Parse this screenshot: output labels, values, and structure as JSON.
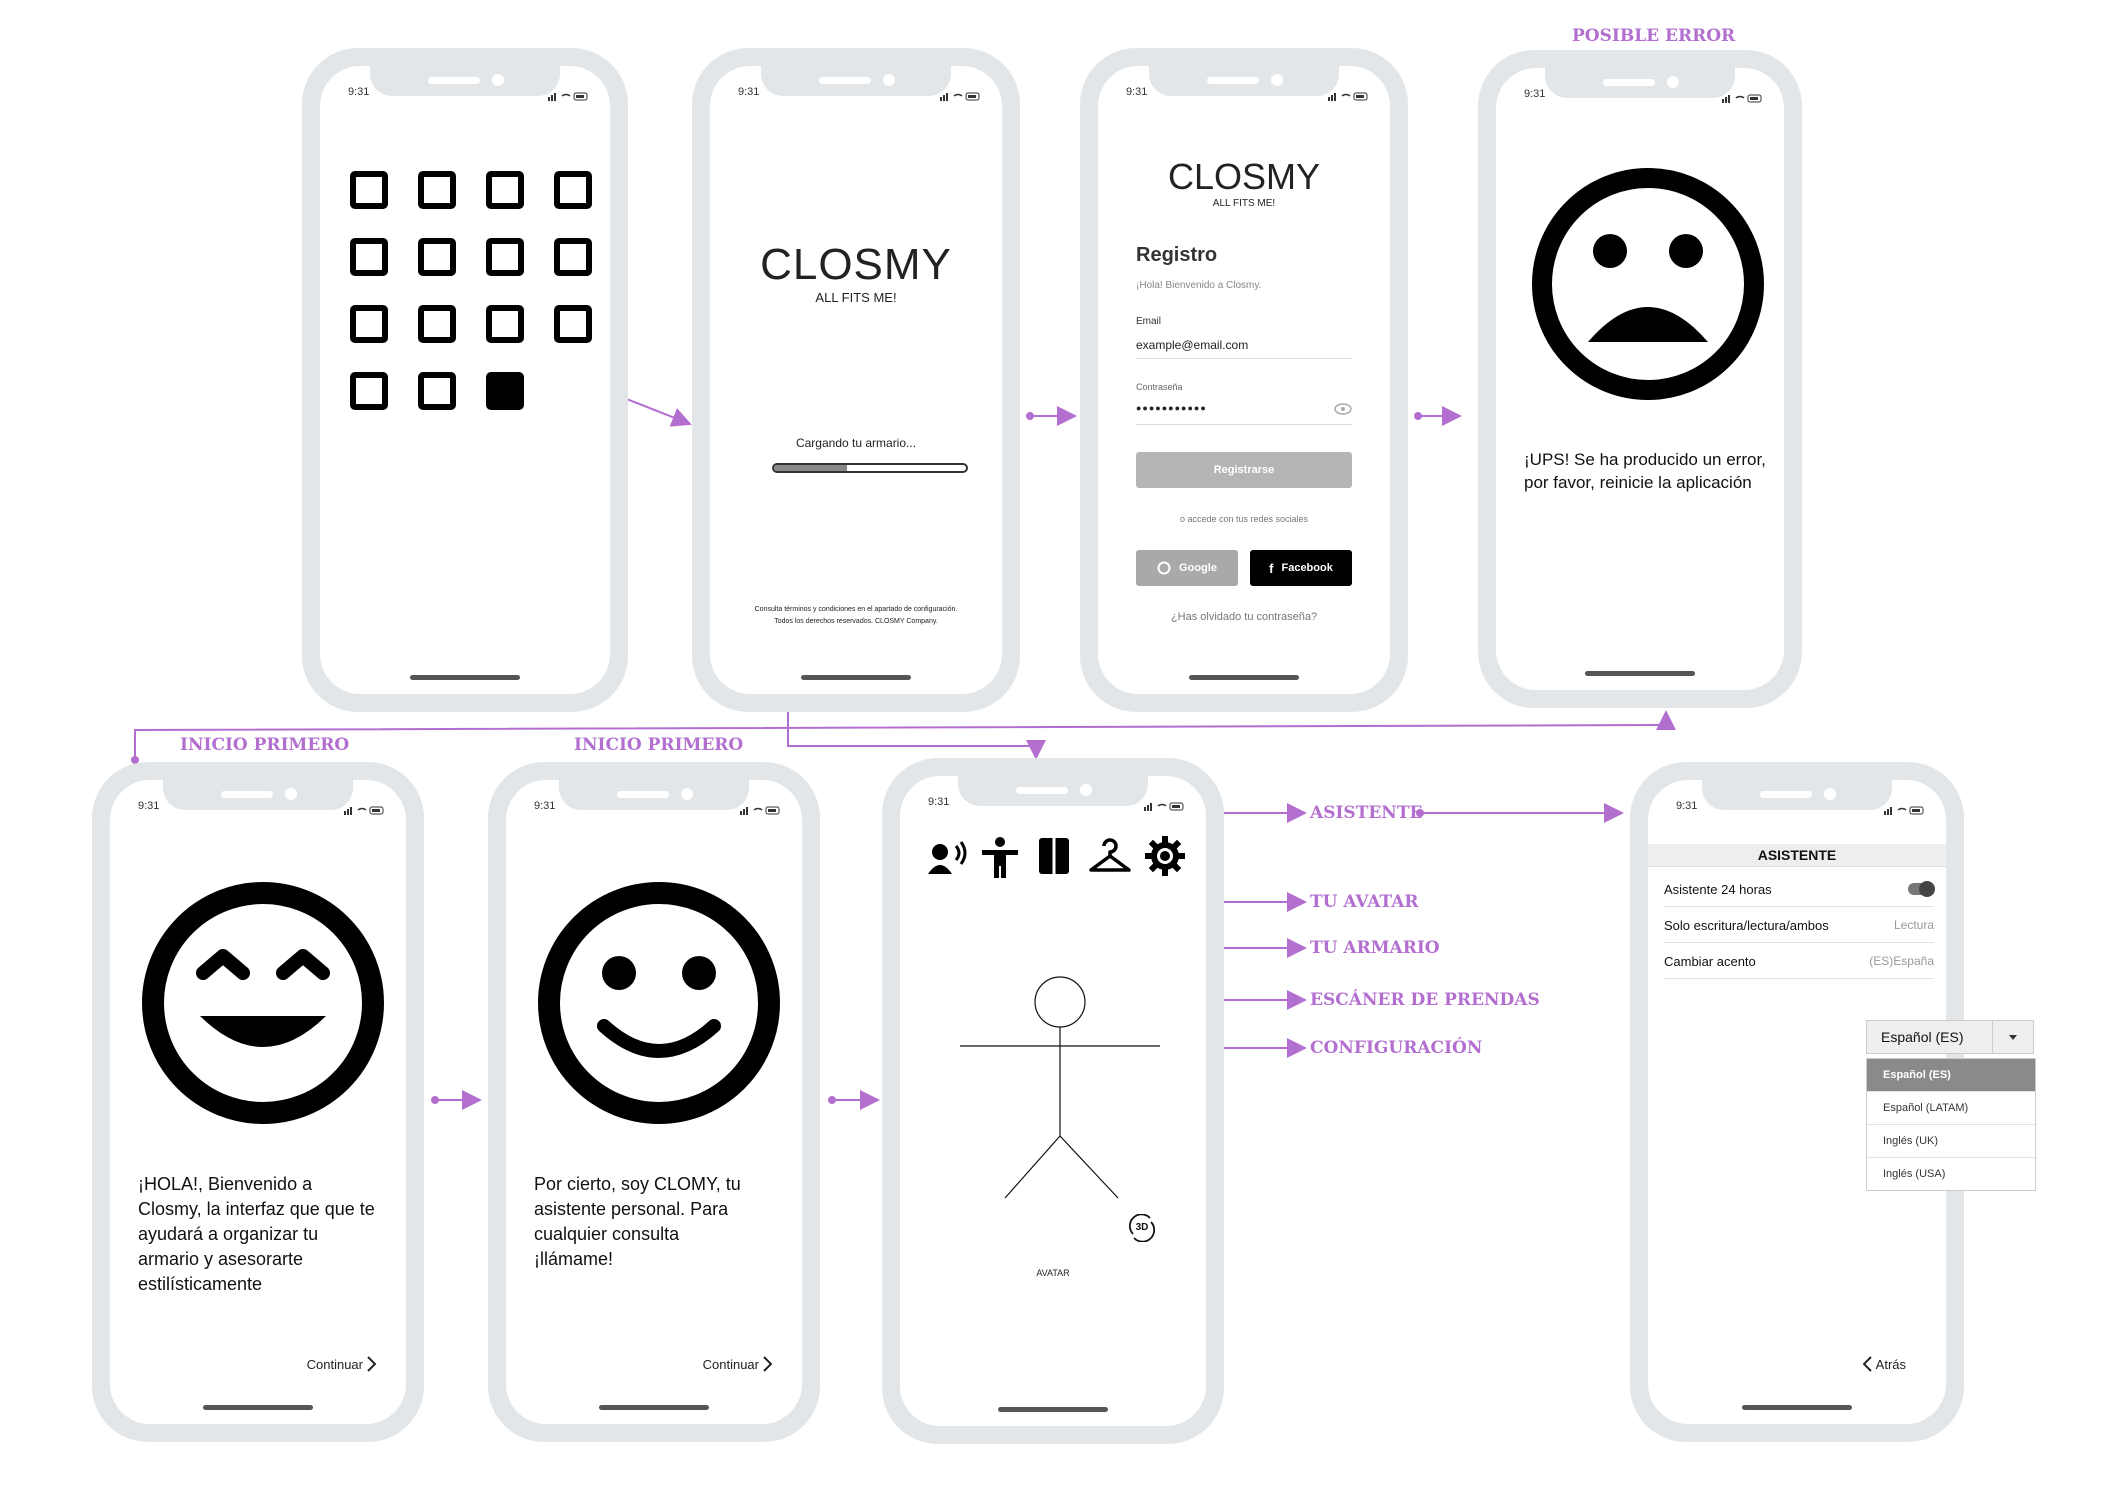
{
  "status_time": "9:31",
  "labels": {
    "posible_error": "POSIBLE ERROR",
    "inicio_primero_1": "INICIO PRIMERO",
    "inicio_primero_2": "INICIO PRIMERO",
    "asistente": "ASISTENTE",
    "tu_avatar": "TU AVATAR",
    "tu_armario": "TU ARMARIO",
    "escaner": "ESCÁNER DE PRENDAS",
    "configuracion": "CONFIGURACIÓN"
  },
  "splash": {
    "brand": "CLOSMY",
    "tagline": "ALL FITS ME!",
    "loading": "Cargando tu armario...",
    "progress": 0.38,
    "footer_1": "Consulta términos y condiciones en el apartado de configuración.",
    "footer_2": "Todos los derechos reservados. CLOSMY Company."
  },
  "register": {
    "brand": "CLOSMY",
    "tagline": "ALL FITS ME!",
    "title": "Registro",
    "welcome": "¡Hola! Bienvenido a Closmy.",
    "email_label": "Email",
    "email_value": "example@email.com",
    "password_label": "Contraseña",
    "password_value": "●●●●●●●●●●●",
    "register_button": "Registrarse",
    "social_text": "o accede con tus redes sociales",
    "google_button": "Google",
    "facebook_button": "Facebook",
    "forgot": "¿Has olvidado tu contraseña?"
  },
  "error": {
    "message": "¡UPS! Se ha producido un error, por favor, reinicie la aplicación"
  },
  "welcome1": {
    "message": "¡HOLA!, Bienvenido a Closmy, la interfaz que que te ayudará a organizar tu armario y asesorarte estilísticamente",
    "continue": "Continuar"
  },
  "welcome2": {
    "message": "Por cierto, soy CLOMY, tu asistente personal. Para cualquier consulta ¡llámame!",
    "continue": "Continuar"
  },
  "avatar": {
    "caption": "AVATAR",
    "badge": "3D"
  },
  "assistant": {
    "title": "ASISTENTE",
    "rows": [
      {
        "label": "Asistente 24 horas",
        "value": ""
      },
      {
        "label": "Solo escritura/lectura/ambos",
        "value": "Lectura"
      },
      {
        "label": "Cambiar acento",
        "value": "(ES)España"
      }
    ],
    "select_value": "Español (ES)",
    "options": [
      "Español (ES)",
      "Español (LATAM)",
      "Inglés (UK)",
      "Inglés (USA)"
    ],
    "back": "Atrás"
  },
  "colors": {
    "accent": "#b36fd0",
    "frame": "#e3e6e9"
  }
}
